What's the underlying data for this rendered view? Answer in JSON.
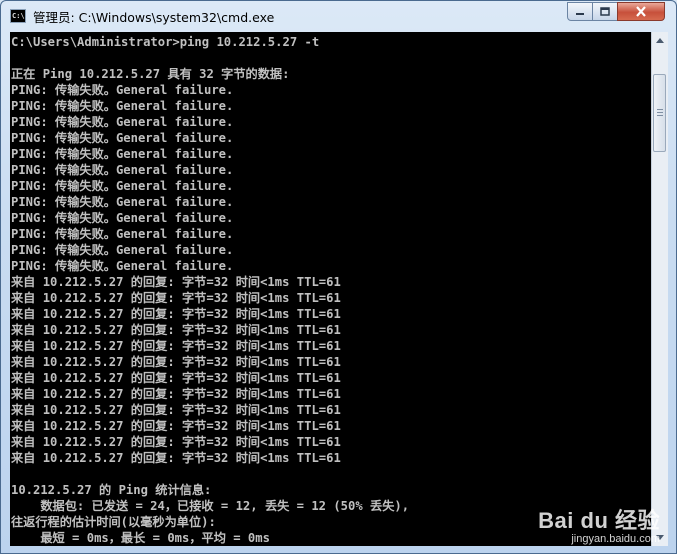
{
  "window": {
    "title": "管理员: C:\\Windows\\system32\\cmd.exe",
    "app_icon_text": "C:\\"
  },
  "console": {
    "lines": [
      "C:\\Users\\Administrator>ping 10.212.5.27 -t",
      "",
      "正在 Ping 10.212.5.27 具有 32 字节的数据:",
      "PING: 传输失败。General failure.",
      "PING: 传输失败。General failure.",
      "PING: 传输失败。General failure.",
      "PING: 传输失败。General failure.",
      "PING: 传输失败。General failure.",
      "PING: 传输失败。General failure.",
      "PING: 传输失败。General failure.",
      "PING: 传输失败。General failure.",
      "PING: 传输失败。General failure.",
      "PING: 传输失败。General failure.",
      "PING: 传输失败。General failure.",
      "PING: 传输失败。General failure.",
      "来自 10.212.5.27 的回复: 字节=32 时间<1ms TTL=61",
      "来自 10.212.5.27 的回复: 字节=32 时间<1ms TTL=61",
      "来自 10.212.5.27 的回复: 字节=32 时间<1ms TTL=61",
      "来自 10.212.5.27 的回复: 字节=32 时间<1ms TTL=61",
      "来自 10.212.5.27 的回复: 字节=32 时间<1ms TTL=61",
      "来自 10.212.5.27 的回复: 字节=32 时间<1ms TTL=61",
      "来自 10.212.5.27 的回复: 字节=32 时间<1ms TTL=61",
      "来自 10.212.5.27 的回复: 字节=32 时间<1ms TTL=61",
      "来自 10.212.5.27 的回复: 字节=32 时间<1ms TTL=61",
      "来自 10.212.5.27 的回复: 字节=32 时间<1ms TTL=61",
      "来自 10.212.5.27 的回复: 字节=32 时间<1ms TTL=61",
      "来自 10.212.5.27 的回复: 字节=32 时间<1ms TTL=61",
      "",
      "10.212.5.27 的 Ping 统计信息:",
      "    数据包: 已发送 = 24，已接收 = 12, 丢失 = 12 (50% 丢失),",
      "往返行程的估计时间(以毫秒为单位):",
      "    最短 = 0ms，最长 = 0ms，平均 = 0ms"
    ]
  },
  "watermark": {
    "logo": "Bai du 经验",
    "url": "jingyan.baidu.com"
  },
  "colors": {
    "console_bg": "#000000",
    "console_text": "#c0c0c0",
    "close_button": "#c7503b"
  }
}
